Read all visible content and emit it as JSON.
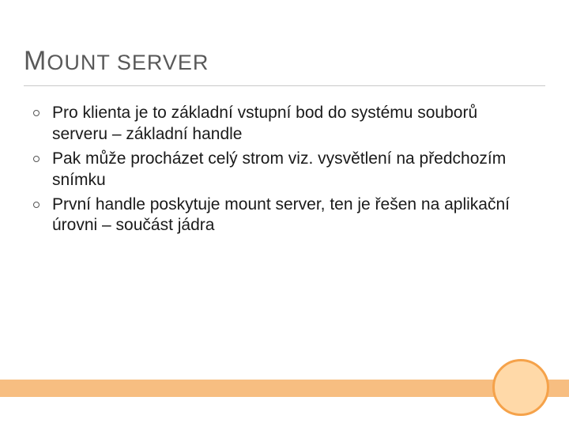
{
  "title": {
    "first": "M",
    "rest": "OUNT SERVER"
  },
  "bullets": [
    "Pro klienta je to základní vstupní bod do systému souborů serveru – základní handle",
    "Pak může procházet celý strom viz. vysvětlení na předchozím snímku",
    "První handle poskytuje mount server, ten je řešen na aplikační úrovni – součást jádra"
  ],
  "theme": {
    "accent": "#f7be81",
    "accent_border": "#f5a24a"
  }
}
